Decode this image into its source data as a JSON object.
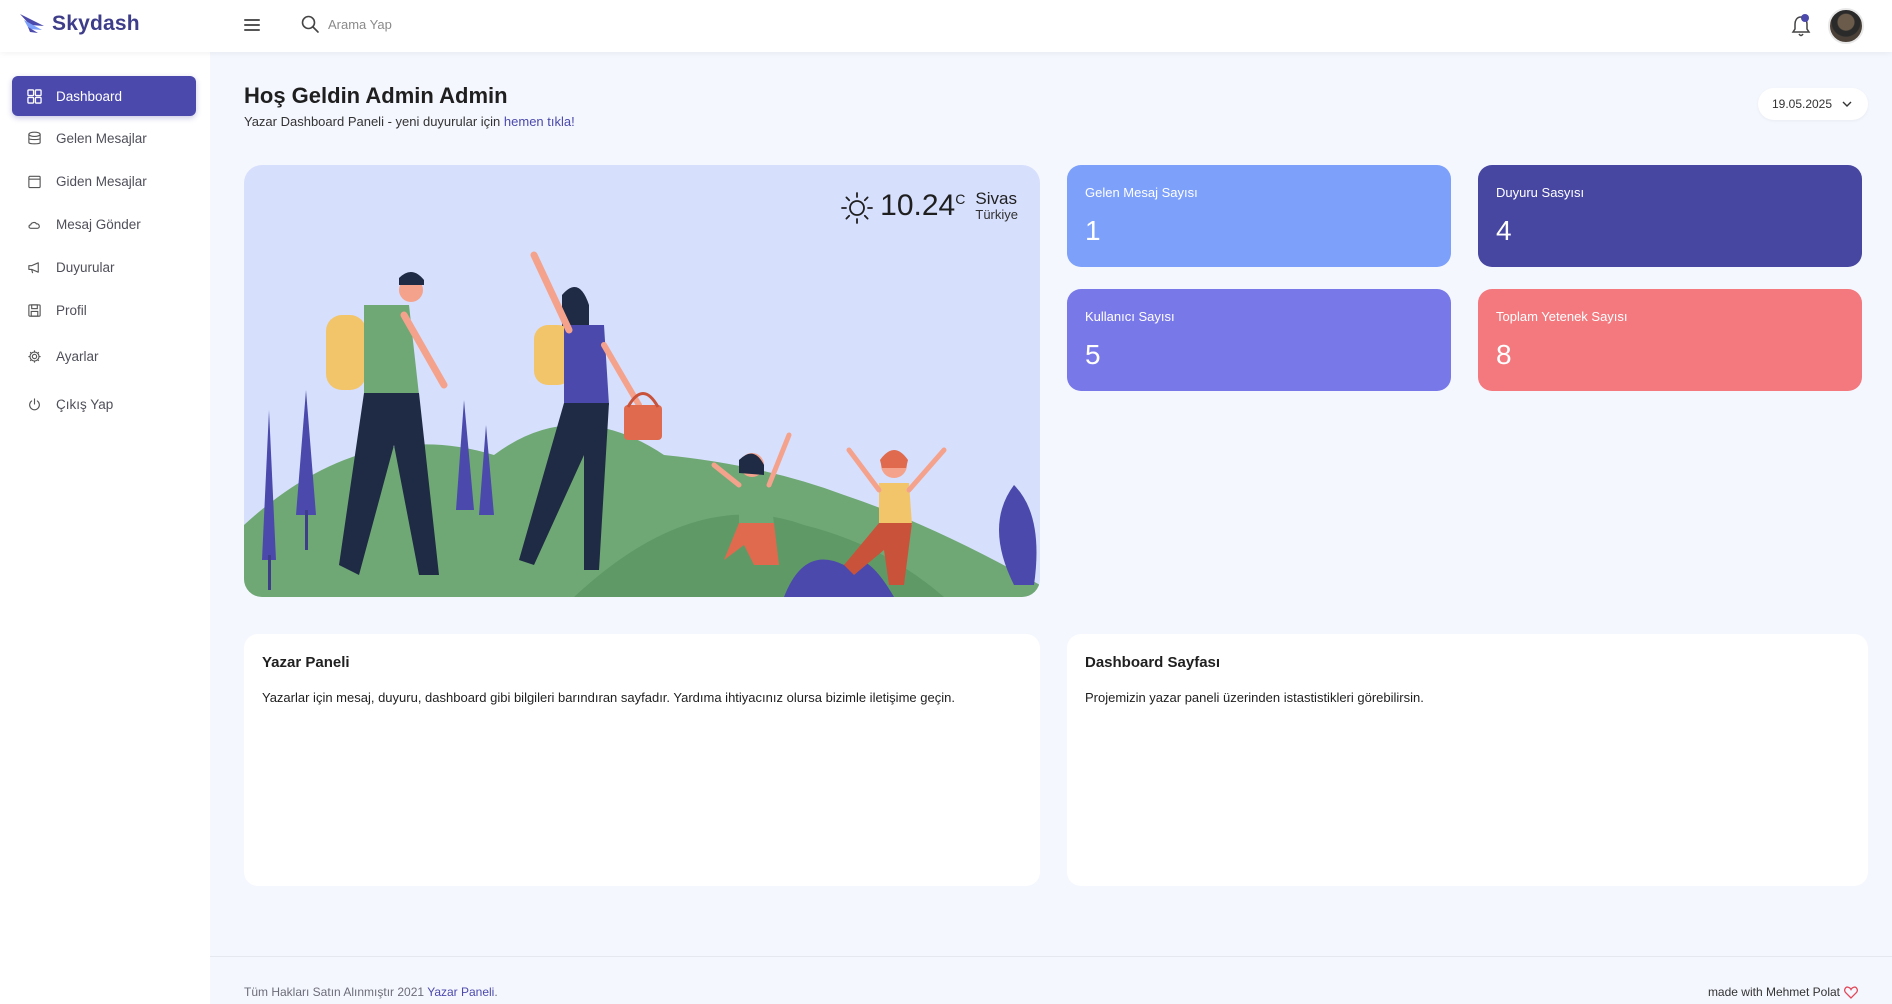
{
  "app": {
    "brand": "Skydash",
    "accent": "#4b49ac"
  },
  "search": {
    "placeholder": "Arama Yap",
    "icon": "search-icon"
  },
  "sidebar": {
    "items": [
      {
        "label": "Dashboard",
        "icon": "grid-icon",
        "active": true
      },
      {
        "label": "Gelen Mesajlar",
        "icon": "database-icon"
      },
      {
        "label": "Giden Mesajlar",
        "icon": "calendar-icon"
      },
      {
        "label": "Mesaj Gönder",
        "icon": "cloud-icon"
      },
      {
        "label": "Duyurular",
        "icon": "megaphone-icon"
      },
      {
        "label": "Profil",
        "icon": "save-icon"
      },
      {
        "label": "Ayarlar",
        "icon": "gear-icon"
      },
      {
        "label": "Çıkış Yap",
        "icon": "power-icon"
      }
    ]
  },
  "header": {
    "title": "Hoş Geldin Admin Admin",
    "subtitle": "Yazar Dashboard Paneli - yeni duyurular için",
    "subtitle_link": "hemen tıkla!",
    "date": "19.05.2025"
  },
  "weather": {
    "temp": "10.24",
    "unit": "C",
    "city": "Sivas",
    "country": "Türkiye"
  },
  "stats": [
    {
      "label": "Gelen Mesaj Sayısı",
      "value": "1",
      "color": "#7da0fa"
    },
    {
      "label": "Duyuru Sasyısı",
      "value": "4",
      "color": "#4747a1"
    },
    {
      "label": "Kullanıcı Sayısı",
      "value": "5",
      "color": "#7978e9"
    },
    {
      "label": "Toplam Yetenek Sayısı",
      "value": "8",
      "color": "#f3797e"
    }
  ],
  "cards": [
    {
      "title": "Yazar Paneli",
      "text": "Yazarlar için mesaj, duyuru, dashboard gibi bilgileri barındıran sayfadır. Yardıma ihtiyacınız olursa bizimle iletişime geçin."
    },
    {
      "title": "Dashboard Sayfası",
      "text": "Projemizin yazar paneli üzerinden istastistikleri görebilirsin."
    }
  ],
  "footer": {
    "copyright": "Tüm Hakları Satın Alınmıştır 2021",
    "link": "Yazar Paneli",
    "made_with": "made with Mehmet Polat"
  }
}
